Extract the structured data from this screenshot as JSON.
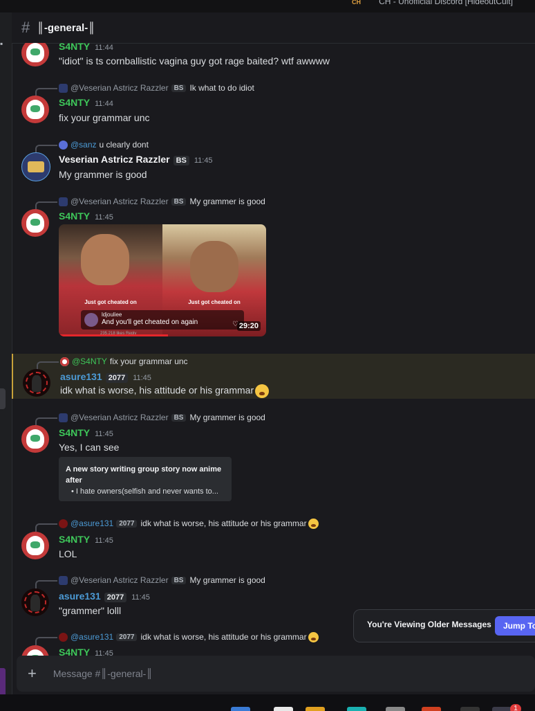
{
  "window": {
    "title": "CH - Unofficial Discord [HideoutCult]",
    "logo_text": "CH"
  },
  "channel": {
    "hash": "#",
    "name": "║-general-║"
  },
  "messages": [
    {
      "author": "S4NTY",
      "time": "11:44",
      "text": "\"idiot\" is ts cornballistic vagina guy got rage baited? wtf awwww"
    },
    {
      "reply": {
        "author": "@Veserian Astricz Razzler",
        "tag": "BS",
        "text": "Ik what to do idiot"
      },
      "author": "S4NTY",
      "time": "11:44",
      "text": "fix your grammar unc"
    },
    {
      "reply": {
        "author": "@sanz",
        "text": "u clearly dont"
      },
      "author": "Veserian Astricz Razzler",
      "tag": "BS",
      "time": "11:45",
      "text": "My grammer is good"
    },
    {
      "reply": {
        "author": "@Veserian Astricz Razzler",
        "tag": "BS",
        "text": "My grammer is good"
      },
      "author": "S4NTY",
      "time": "11:45",
      "media": {
        "caption_left": "Just got cheated on",
        "caption_right": "Just got cheated on",
        "comment_user": "ldjouliee",
        "comment_text": "And you'll get cheated on again",
        "likes": "235,218 likes   Reply",
        "duration": "29:20"
      }
    },
    {
      "reply": {
        "author": "@S4NTY",
        "text": "fix your grammar unc"
      },
      "author": "asure131",
      "tag": "2077",
      "time": "11:45",
      "text": "idk what is worse, his attitude or his grammar"
    },
    {
      "reply": {
        "author": "@Veserian Astricz Razzler",
        "tag": "BS",
        "text": "My grammer is good"
      },
      "author": "S4NTY",
      "time": "11:45",
      "text": "Yes, I can see",
      "embed": {
        "line1": "A new story writing group story now anime after",
        "line2": "• I hate owners(selfish and never wants to..."
      }
    },
    {
      "reply": {
        "author": "@asure131",
        "tag": "2077",
        "text": "idk what is worse, his attitude or his grammar"
      },
      "author": "S4NTY",
      "time": "11:45",
      "text": "LOL"
    },
    {
      "reply": {
        "author": "@Veserian Astricz Razzler",
        "tag": "BS",
        "text": "My grammer is good"
      },
      "author": "asure131",
      "tag": "2077",
      "time": "11:45",
      "text": "\"grammer\" lolll"
    },
    {
      "reply": {
        "author": "@asure131",
        "tag": "2077",
        "text": "idk what is worse, his attitude or his grammar"
      },
      "author": "S4NTY",
      "time": "11:45"
    }
  ],
  "composer": {
    "placeholder": "Message #║-general-║"
  },
  "older_banner": {
    "text": "You're Viewing Older Messages",
    "button": "Jump To"
  },
  "taskbar": {
    "badge": "1"
  },
  "colors": {
    "green_name": "#3ec75a",
    "blue_name": "#4c9bd6",
    "accent": "#5865f2",
    "highlight": "#2b2a22"
  }
}
